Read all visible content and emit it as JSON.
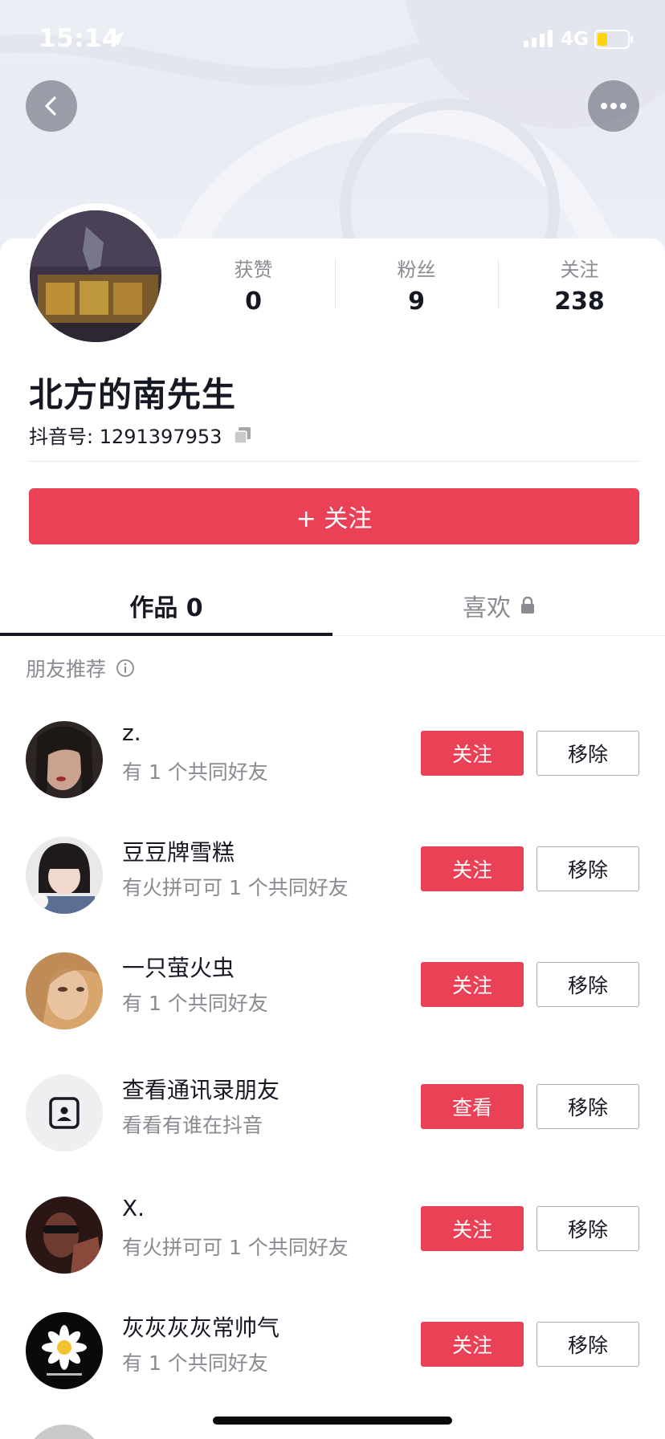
{
  "status_bar": {
    "time": "15:14",
    "network": "4G"
  },
  "profile": {
    "nickname": "北方的南先生",
    "douyin_id": "抖音号: 1291397953",
    "stats": [
      {
        "label": "获赞",
        "value": "0"
      },
      {
        "label": "粉丝",
        "value": "9"
      },
      {
        "label": "关注",
        "value": "238"
      }
    ],
    "follow_button": "+ 关注"
  },
  "tabs": [
    {
      "label": "作品 0",
      "active": true
    },
    {
      "label": "喜欢",
      "locked": true
    }
  ],
  "recommendations": {
    "header": "朋友推荐",
    "items": [
      {
        "name": "z.",
        "subtitle": "有 1 个共同好友",
        "action": "关注",
        "remove": "移除"
      },
      {
        "name": "豆豆牌雪糕",
        "subtitle": "有火拼可可 1 个共同好友",
        "action": "关注",
        "remove": "移除"
      },
      {
        "name": "一只萤火虫",
        "subtitle": "有 1 个共同好友",
        "action": "关注",
        "remove": "移除"
      },
      {
        "name": "查看通讯录朋友",
        "subtitle": "看看有谁在抖音",
        "action": "查看",
        "remove": "移除"
      },
      {
        "name": "X.",
        "subtitle": "有火拼可可 1 个共同好友",
        "action": "关注",
        "remove": "移除"
      },
      {
        "name": "灰灰灰灰常帅气",
        "subtitle": "有 1 个共同好友",
        "action": "关注",
        "remove": "移除"
      }
    ]
  },
  "colors": {
    "accent": "#ea4157",
    "text_primary": "#161823",
    "text_secondary": "#8a8b91"
  }
}
